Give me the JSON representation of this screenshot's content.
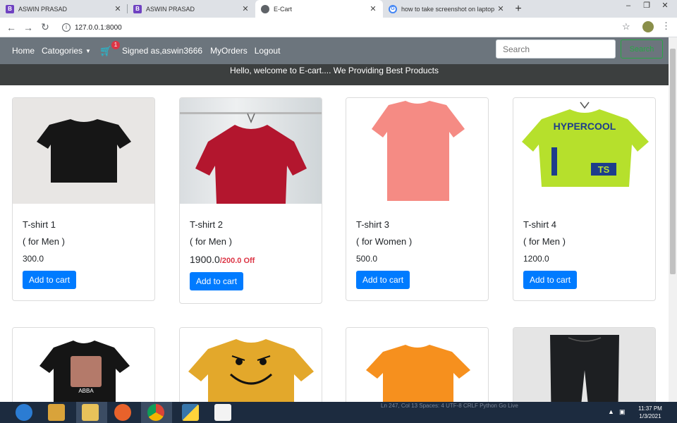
{
  "browser": {
    "tabs": [
      {
        "title": "ASWIN PRASAD",
        "favicon": "bootstrap-icon",
        "active": false
      },
      {
        "title": "ASWIN PRASAD",
        "favicon": "bootstrap-icon",
        "active": false
      },
      {
        "title": "E-Cart",
        "favicon": "globe-icon",
        "active": true
      },
      {
        "title": "how to take screenshot on laptop",
        "favicon": "google-icon",
        "active": false
      }
    ],
    "url": "127.0.0.1:8000"
  },
  "navbar": {
    "home": "Home",
    "categories": "Catogories",
    "cart_count": "1",
    "signed_in": "Signed as,aswin3666",
    "orders": "MyOrders",
    "logout": "Logout",
    "search_placeholder": "Search",
    "search_button": "Search"
  },
  "banner": "Hello, welcome to E-cart.... We Providing Best Products",
  "products": [
    {
      "name": "T-shirt 1",
      "gender": "( for Men )",
      "price": "300.0",
      "discount": "",
      "button": "Add to cart"
    },
    {
      "name": "T-shirt 2",
      "gender": "( for Men )",
      "price": "1900.0",
      "discount": "/200.0 Off",
      "button": "Add to cart"
    },
    {
      "name": "T-shirt 3",
      "gender": "( for Women )",
      "price": "500.0",
      "discount": "",
      "button": "Add to cart"
    },
    {
      "name": "T-shirt 4",
      "gender": "( for Men )",
      "price": "1200.0",
      "discount": "",
      "button": "Add to cart"
    }
  ],
  "images": {
    "tshirt4_print": "HYPERCOOL",
    "tshirt4_badge": "TS",
    "row2_tshirt_print": "ABBA"
  },
  "taskbar": {
    "status": "Ln 247, Col 13   Spaces: 4   UTF-8   CRLF   Python   Go Live",
    "time": "11:37 PM",
    "date": "1/3/2021"
  },
  "colors": {
    "navbar_bg": "#6c757d",
    "banner_bg": "#3c3f3f",
    "primary_button": "#007bff",
    "discount_text": "#dc3545",
    "search_button": "#28a745"
  }
}
